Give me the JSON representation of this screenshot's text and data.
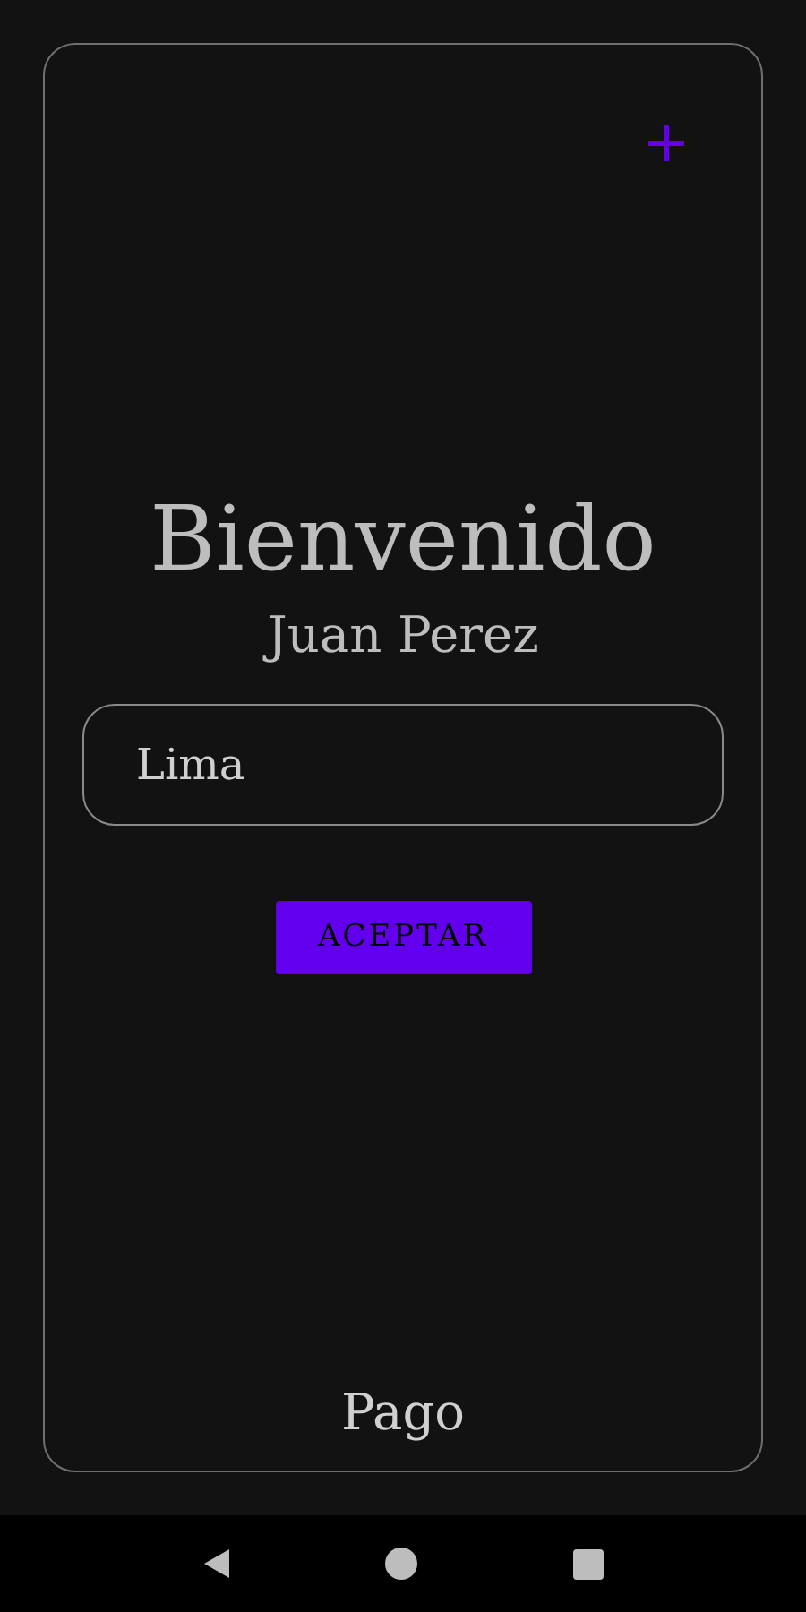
{
  "title": "Bienvenido",
  "user_name": "Juan Perez",
  "city_field": {
    "value": "Lima"
  },
  "accept_button": {
    "label": "ACEPTAR"
  },
  "footer_label": "Pago"
}
